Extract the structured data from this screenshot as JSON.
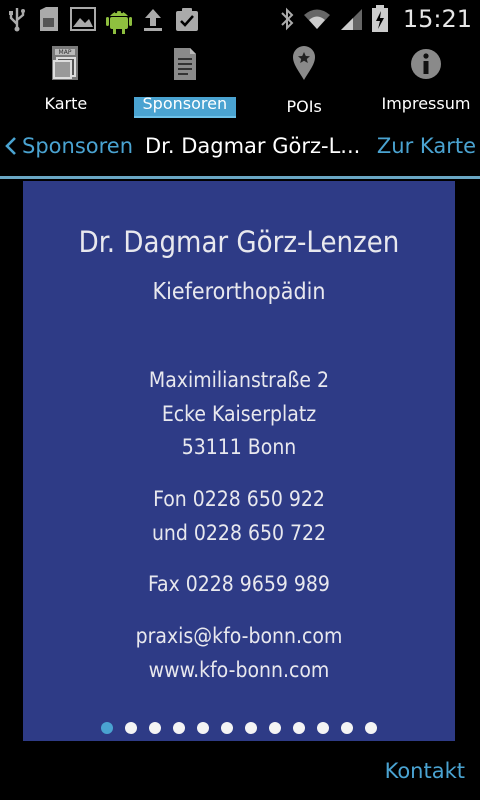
{
  "status_bar": {
    "time": "15:21",
    "left_icons": [
      "usb-icon",
      "sd-card-icon",
      "image-icon",
      "android-icon",
      "upload-icon",
      "clipboard-check-icon"
    ],
    "right_icons": [
      "bluetooth-icon",
      "wifi-icon",
      "signal-icon",
      "battery-charging-icon"
    ]
  },
  "tabs": [
    {
      "label": "Karte",
      "icon": "map-icon",
      "active": false
    },
    {
      "label": "Sponsoren",
      "icon": "document-icon",
      "active": true
    },
    {
      "label": "POIs",
      "icon": "map-pin-icon",
      "active": false
    },
    {
      "label": "Impressum",
      "icon": "info-icon",
      "active": false
    }
  ],
  "navbar": {
    "back_label": "Sponsoren",
    "title": "Dr. Dagmar Görz-L...",
    "right_label": "Zur Karte"
  },
  "card": {
    "name": "Dr. Dagmar Görz-Lenzen",
    "specialty": "Kieferorthopädin",
    "address_line1": "Maximilianstraße 2",
    "address_line2": "Ecke Kaiserplatz",
    "address_line3": "53111 Bonn",
    "phone_line1": "Fon 0228 650 922",
    "phone_line2": "und 0228 650 722",
    "fax": "Fax 0228 9659 989",
    "email": "praxis@kfo-bonn.com",
    "website": "www.kfo-bonn.com",
    "background_color": "#2e3b86"
  },
  "pager": {
    "count": 12,
    "active_index": 0
  },
  "footer": {
    "kontakt_label": "Kontakt"
  },
  "colors": {
    "accent": "#4aa3d1",
    "card": "#2e3b86"
  }
}
